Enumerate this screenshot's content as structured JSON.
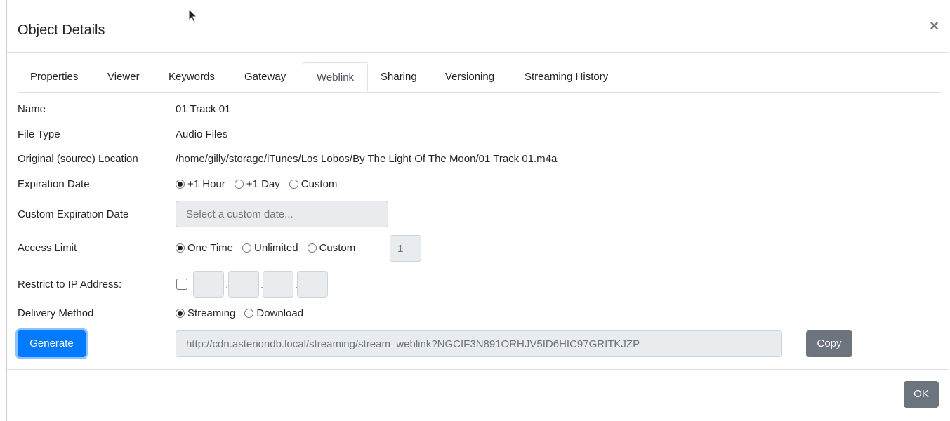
{
  "dialog": {
    "title": "Object Details",
    "close_symbol": "×"
  },
  "tabs": [
    {
      "label": "Properties"
    },
    {
      "label": "Viewer"
    },
    {
      "label": "Keywords"
    },
    {
      "label": "Gateway"
    },
    {
      "label": "Weblink",
      "active": true
    },
    {
      "label": "Sharing"
    },
    {
      "label": "Versioning"
    },
    {
      "label": "Streaming History"
    }
  ],
  "fields": {
    "name": {
      "label": "Name",
      "value": "01 Track 01"
    },
    "file_type": {
      "label": "File Type",
      "value": "Audio Files"
    },
    "location": {
      "label": "Original (source) Location",
      "value": "/home/gilly/storage/iTunes/Los Lobos/By The Light Of The Moon/01 Track 01.m4a"
    },
    "expiration": {
      "label": "Expiration Date",
      "options": [
        "+1 Hour",
        "+1 Day",
        "Custom"
      ],
      "selected": "+1 Hour"
    },
    "custom_expiration": {
      "label": "Custom Expiration Date",
      "placeholder": "Select a custom date..."
    },
    "access_limit": {
      "label": "Access Limit",
      "options": [
        "One Time",
        "Unlimited",
        "Custom"
      ],
      "selected": "One Time",
      "custom_value": "1"
    },
    "restrict_ip": {
      "label": "Restrict to IP Address:",
      "checked": false,
      "separator": "."
    },
    "delivery": {
      "label": "Delivery Method",
      "options": [
        "Streaming",
        "Download"
      ],
      "selected": "Streaming"
    }
  },
  "actions": {
    "generate_label": "Generate",
    "weblink_url": "http://cdn.asteriondb.local/streaming/stream_weblink?NGCIF3N891ORHJV5ID6HIC97GRITKJZP",
    "copy_label": "Copy",
    "ok_label": "OK"
  },
  "colors": {
    "primary": "#007bff",
    "secondary": "#6c757d",
    "disabled_input": "#e9ecef"
  }
}
